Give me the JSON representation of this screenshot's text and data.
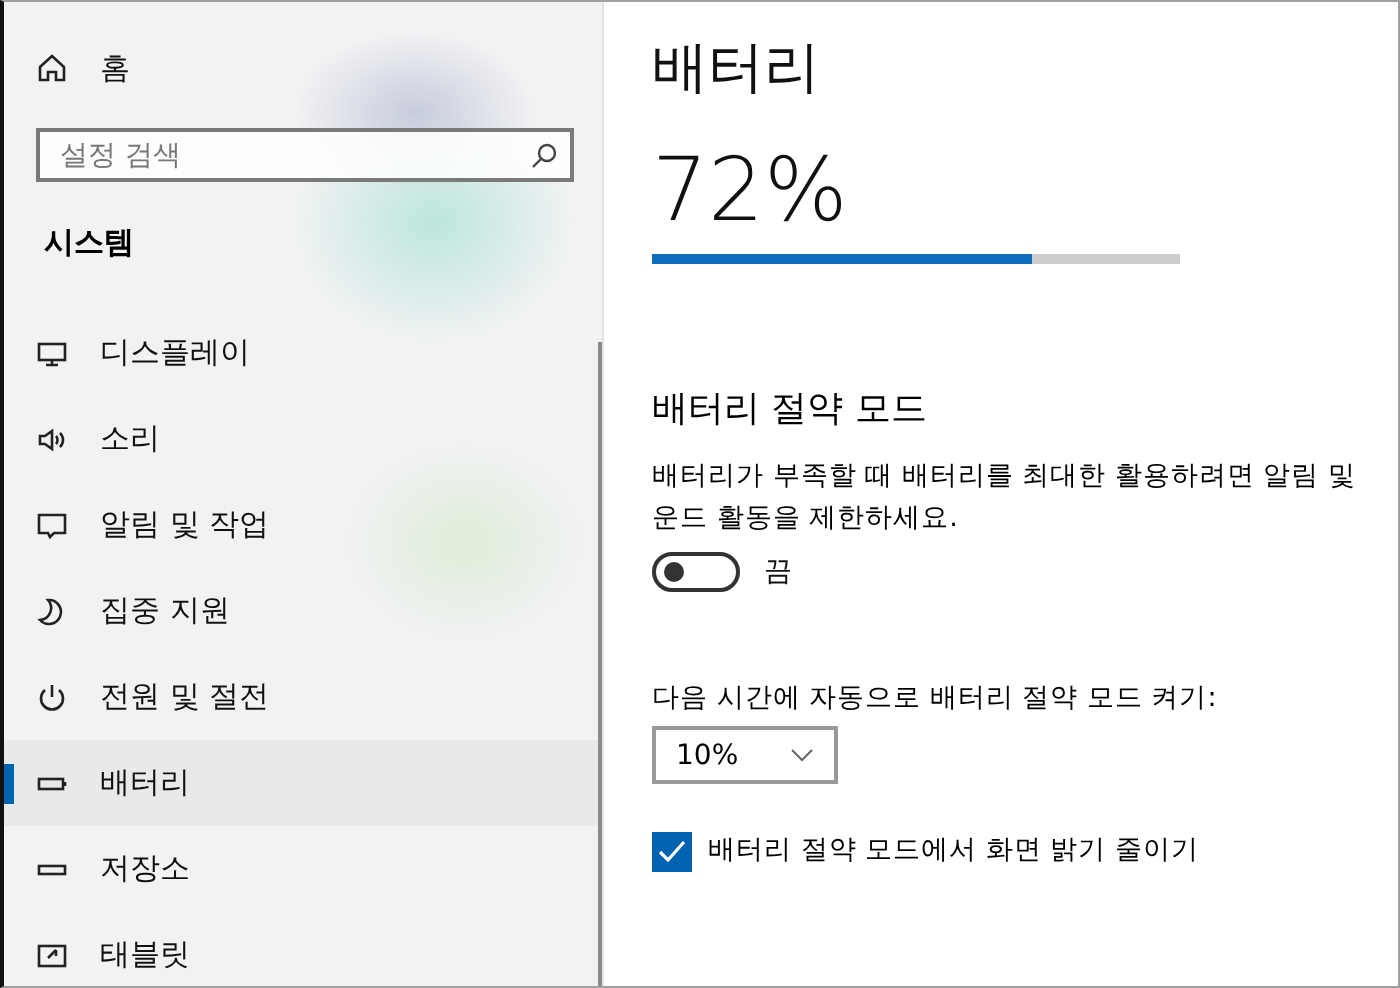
{
  "sidebar": {
    "home": {
      "label": "홈"
    },
    "search": {
      "placeholder": "설정 검색"
    },
    "section_title": "시스템",
    "items": [
      {
        "kind": "display",
        "label": "디스플레이",
        "selected": false
      },
      {
        "kind": "sound",
        "label": "소리",
        "selected": false
      },
      {
        "kind": "notifications",
        "label": "알림 및 작업",
        "selected": false
      },
      {
        "kind": "focus",
        "label": "집중 지원",
        "selected": false
      },
      {
        "kind": "power",
        "label": "전원 및 절전",
        "selected": false
      },
      {
        "kind": "battery",
        "label": "배터리",
        "selected": true
      },
      {
        "kind": "storage",
        "label": "저장소",
        "selected": false
      },
      {
        "kind": "tablet",
        "label": "태블릿",
        "selected": false
      }
    ]
  },
  "page": {
    "title": "배터리",
    "percent": "72%",
    "battery": {
      "level": 0.72
    },
    "saver": {
      "heading": "배터리 절약 모드",
      "description": [
        "배터리가 부족할 때 배터리를 최대한 활용하려면 알림 및",
        "운드 활동을 제한하세요."
      ],
      "toggle": {
        "on": false,
        "label": "끔"
      },
      "auto_label": "다음 시간에 자동으로 배터리 절약 모드 켜기:",
      "threshold": {
        "value": "10%"
      },
      "dim_checkbox": {
        "checked": true,
        "label": "배터리 절약 모드에서 화면 밝기 줄이기"
      }
    }
  }
}
